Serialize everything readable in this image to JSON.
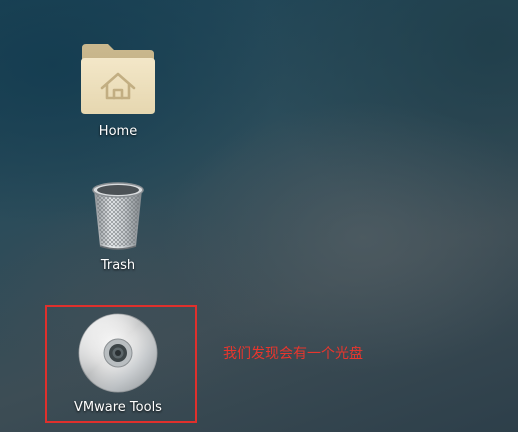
{
  "desktop": {
    "icons": [
      {
        "label": "Home",
        "icon": "home-folder-icon"
      },
      {
        "label": "Trash",
        "icon": "trash-icon"
      },
      {
        "label": "VMware Tools",
        "icon": "optical-disc-icon"
      }
    ]
  },
  "annotation": {
    "text": "我们发现会有一个光盘",
    "color": "#e8362d",
    "box_color": "#e0302c"
  }
}
